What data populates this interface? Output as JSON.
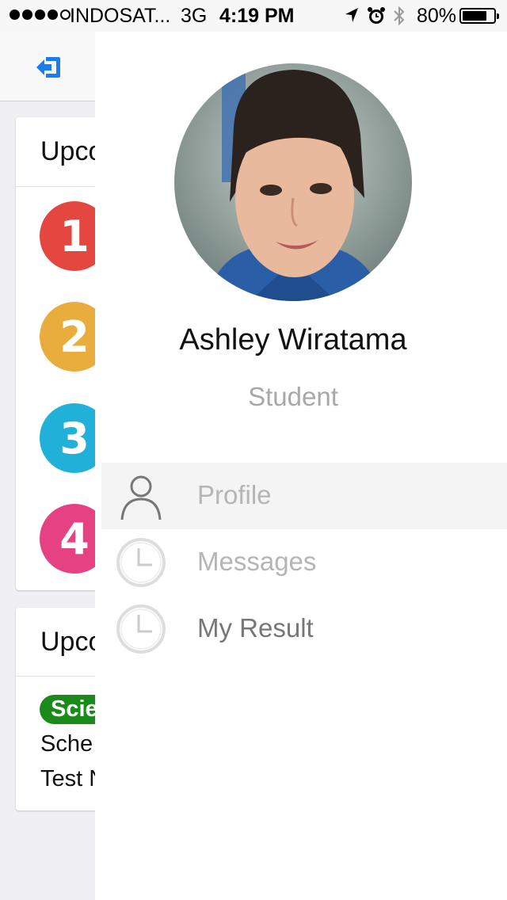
{
  "status_bar": {
    "carrier": "INDOSAT...",
    "network": "3G",
    "time": "4:19 PM",
    "battery_percent": "80%",
    "battery_level": 0.8,
    "signal_bars_filled": 4,
    "signal_bars_total": 5
  },
  "background_screen": {
    "card1_title": "Upco",
    "numbers": [
      "1",
      "2",
      "3",
      "4"
    ],
    "number_colors": [
      "#e4473f",
      "#e9ad3d",
      "#21b1d8",
      "#e64283"
    ],
    "card2_title": "Upco",
    "subject_tag": "Scie",
    "line1": "Sche",
    "line2": "Test N"
  },
  "drawer": {
    "user_name": "Ashley Wiratama",
    "user_role": "Student",
    "menu": [
      {
        "label": "Profile",
        "icon": "user-icon",
        "active": true
      },
      {
        "label": "Messages",
        "icon": "clock-icon",
        "active": false
      },
      {
        "label": "My Result",
        "icon": "clock-icon",
        "active": false
      }
    ]
  },
  "colors": {
    "accent_blue": "#1a7cf3",
    "tag_green": "#1a8a1a",
    "indicator_red": "#f07070"
  }
}
